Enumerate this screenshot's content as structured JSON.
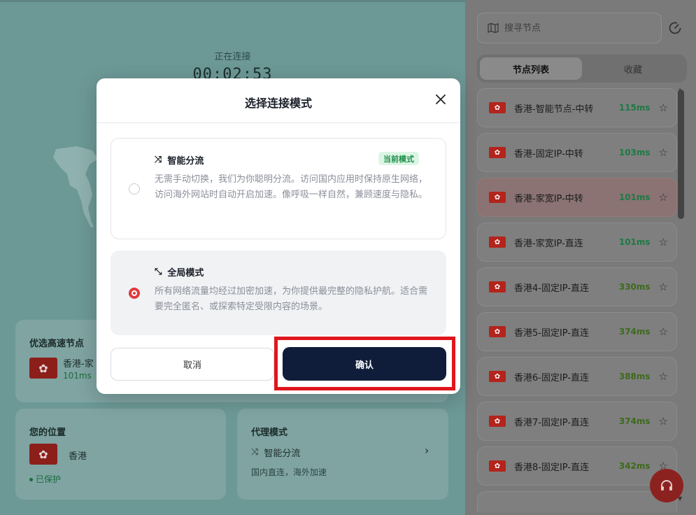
{
  "main": {
    "connection_status": "正在连接",
    "timer": "00:02:53",
    "best_node_card": {
      "title": "优选高速节点",
      "node_name": "香港-家",
      "ping": "101ms"
    },
    "location_card": {
      "title": "您的位置",
      "location": "香港",
      "status": "已保护"
    },
    "proxy_card": {
      "title": "代理模式",
      "mode": "智能分流",
      "desc": "国内直连，海外加速"
    }
  },
  "sidebar": {
    "search_placeholder": "搜寻节点",
    "tabs": [
      {
        "label": "节点列表",
        "active": true
      },
      {
        "label": "收藏",
        "active": false
      }
    ],
    "nodes": [
      {
        "name": "香港-智能节点-中转",
        "ping": "115ms",
        "ping_color": "#1d7a45"
      },
      {
        "name": "香港-固定IP-中转",
        "ping": "103ms",
        "ping_color": "#1d7a45"
      },
      {
        "name": "香港-家宽IP-中转",
        "ping": "101ms",
        "ping_color": "#1d7a45"
      },
      {
        "name": "香港-家宽IP-直连",
        "ping": "101ms",
        "ping_color": "#1d7a45"
      },
      {
        "name": "香港4-固定IP-直连",
        "ping": "330ms",
        "ping_color": "#3d6a1c"
      },
      {
        "name": "香港5-固定IP-直连",
        "ping": "374ms",
        "ping_color": "#3d6a1c"
      },
      {
        "name": "香港6-固定IP-直连",
        "ping": "388ms",
        "ping_color": "#3d6a1c"
      },
      {
        "name": "香港7-固定IP-直连",
        "ping": "374ms",
        "ping_color": "#3d6a1c"
      },
      {
        "name": "香港8-固定IP-直连",
        "ping": "342ms",
        "ping_color": "#3d6a1c"
      }
    ]
  },
  "modal": {
    "title": "选择连接模式",
    "smart": {
      "title": "智能分流",
      "badge": "当前模式",
      "desc": "无需手动切换，我们为你聪明分流。访问国内应用时保持原生网络，访问海外网站时自动开启加速。像呼吸一样自然，兼顾速度与隐私。",
      "selected": false
    },
    "global": {
      "title": "全局模式",
      "desc": "所有网络流量均经过加密加速，为你提供最完整的隐私护航。适合需要完全匿名、或探索特定受限内容的场景。",
      "selected": true
    },
    "cancel_label": "取消",
    "confirm_label": "确认"
  },
  "colors": {
    "accent_red": "#e03a3e",
    "confirm_bg": "#101d3a",
    "badge_green": "#1f8f4a",
    "highlight_red": "#e0161d"
  }
}
